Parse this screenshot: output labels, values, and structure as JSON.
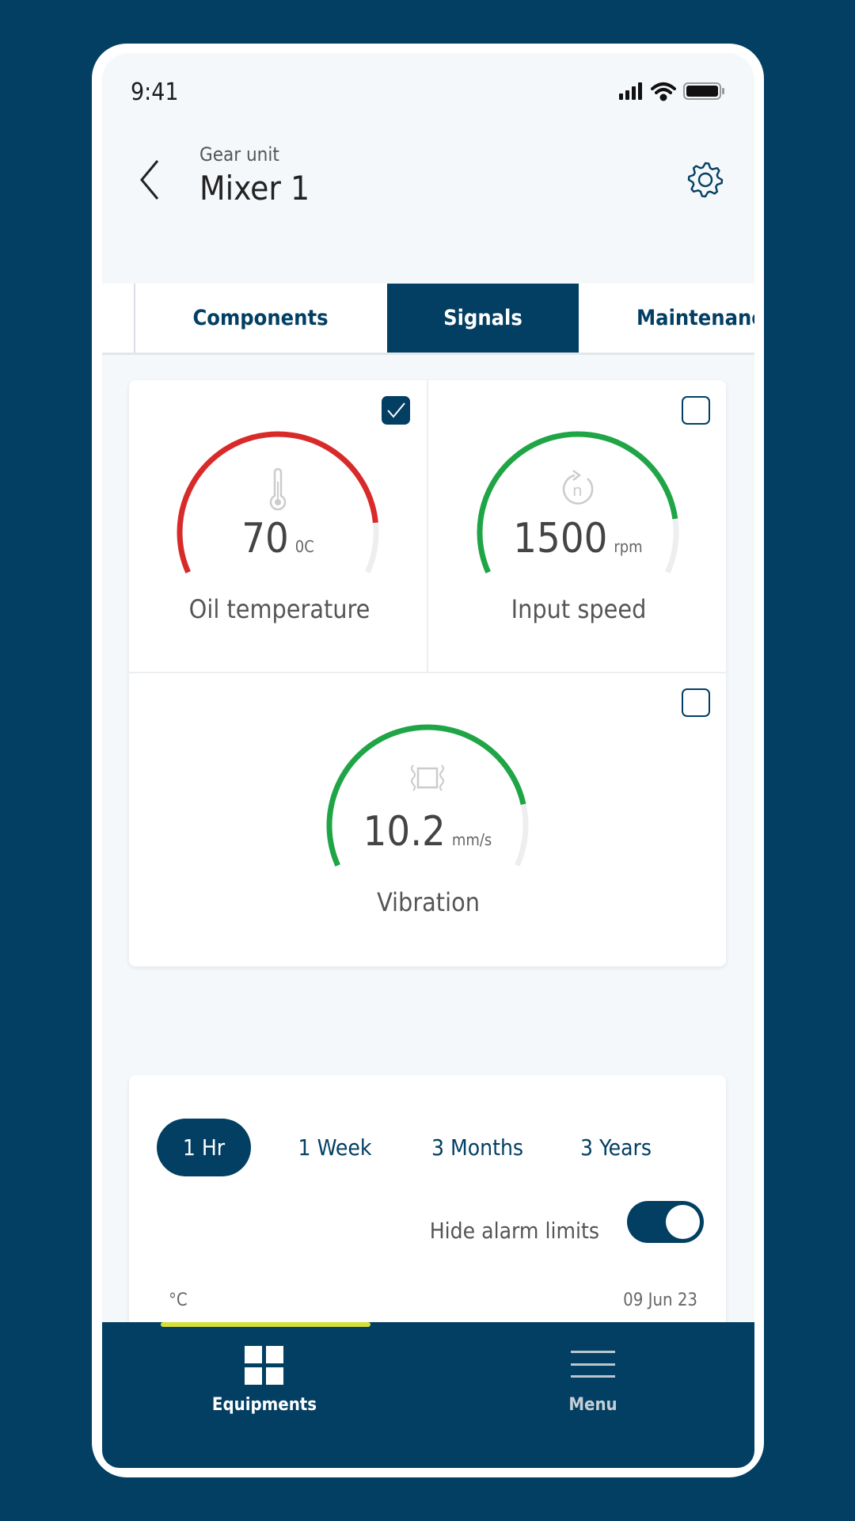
{
  "status_bar": {
    "time": "9:41",
    "icons": [
      "signal-icon",
      "wifi-icon",
      "battery-icon"
    ]
  },
  "header": {
    "subtitle": "Gear unit",
    "title": "Mixer 1",
    "back_icon": "chevron-left-icon",
    "settings_icon": "gear-icon"
  },
  "tabs": [
    {
      "label": "Components",
      "active": false
    },
    {
      "label": "Signals",
      "active": true
    },
    {
      "label": "Maintenance",
      "active": false
    }
  ],
  "signals": [
    {
      "label": "Oil temperature",
      "value": "70",
      "unit": "0C",
      "icon": "thermometer-icon",
      "checked": true,
      "gauge_color": "#d92a2a",
      "gauge_fill": 0.87
    },
    {
      "label": "Input speed",
      "value": "1500",
      "unit": "rpm",
      "icon": "rotation-speed-icon",
      "checked": false,
      "gauge_color": "#1fa546",
      "gauge_fill": 0.86
    },
    {
      "label": "Vibration",
      "value": "10.2",
      "unit": "mm/s",
      "icon": "vibration-icon",
      "checked": false,
      "gauge_color": "#1fa546",
      "gauge_fill": 0.84
    }
  ],
  "chart_panel": {
    "ranges": [
      {
        "label": "1 Hr",
        "active": true
      },
      {
        "label": "1 Week",
        "active": false
      },
      {
        "label": "3 Months",
        "active": false
      },
      {
        "label": "3 Years",
        "active": false
      }
    ],
    "hide_alarm_label": "Hide alarm limits",
    "hide_alarm_on": true,
    "y_unit": "°C",
    "date": "09 Jun 23"
  },
  "bottom_nav": [
    {
      "label": "Equipments",
      "icon": "grid-icon",
      "active": true
    },
    {
      "label": "Menu",
      "icon": "hamburger-menu-icon",
      "active": false
    }
  ],
  "colors": {
    "brand": "#033f63",
    "accent": "#d5df3c",
    "background": "#f4f8fb"
  }
}
